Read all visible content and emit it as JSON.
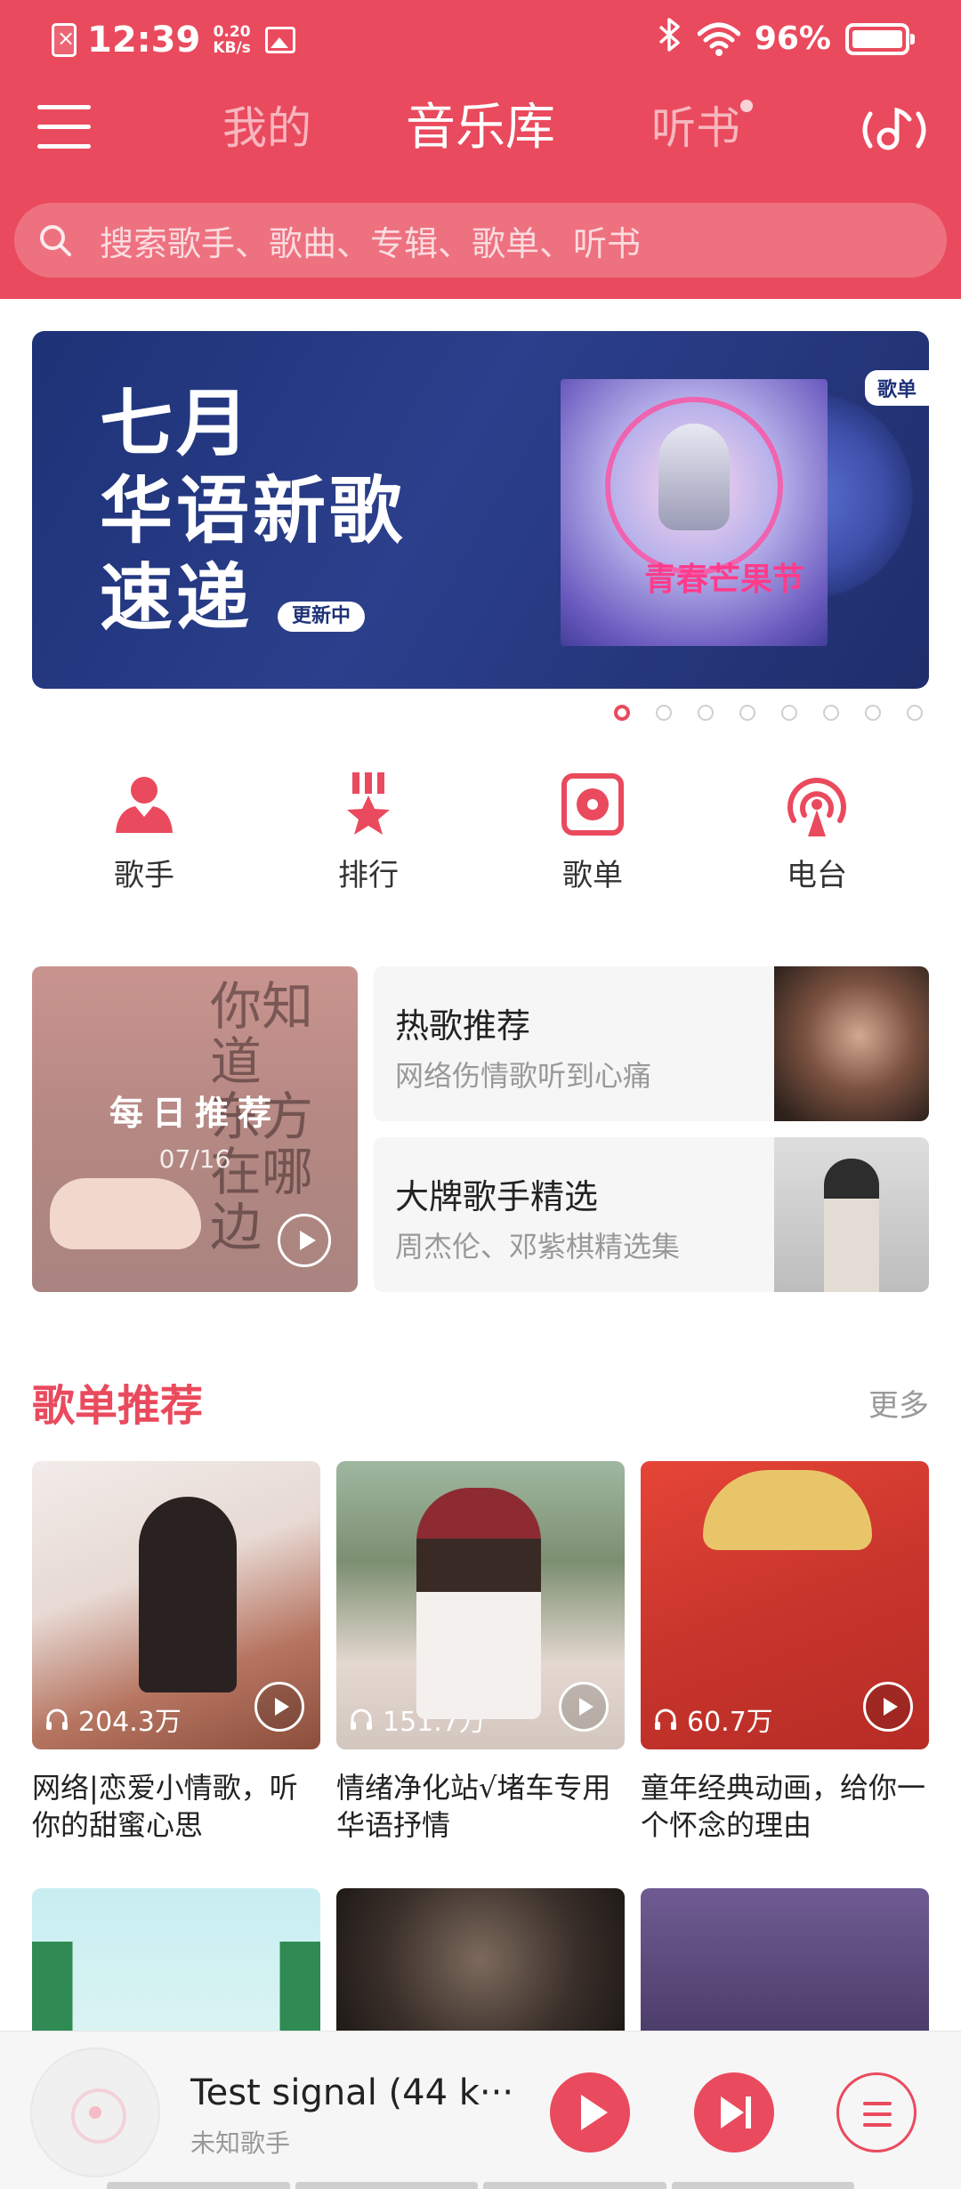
{
  "status_bar": {
    "time": "12:39",
    "speed_value": "0.20",
    "speed_unit": "KB/s",
    "battery": "96%"
  },
  "topnav": {
    "tab_mine": "我的",
    "tab_library": "音乐库",
    "tab_audiobook": "听书"
  },
  "search": {
    "placeholder": "搜索歌手、歌曲、专辑、歌单、听书"
  },
  "banner": {
    "line1": "七月",
    "line2": "华语新歌",
    "line3": "速递",
    "updating_badge": "更新中",
    "tag": "歌单",
    "art_text": "青春芒果节",
    "page_count": 8,
    "active_page": 1
  },
  "quick_entries": [
    {
      "label": "歌手",
      "icon": "singer-icon"
    },
    {
      "label": "排行",
      "icon": "ranking-icon"
    },
    {
      "label": "歌单",
      "icon": "playlist-icon"
    },
    {
      "label": "电台",
      "icon": "radio-icon"
    }
  ],
  "daily": {
    "title": "每日推荐",
    "date": "07/16",
    "calligraphy": "你知道\n东方\n在哪边"
  },
  "recommend_cards": [
    {
      "title": "热歌推荐",
      "subtitle": "网络伤情歌听到心痛"
    },
    {
      "title": "大牌歌手精选",
      "subtitle": "周杰伦、邓紫棋精选集"
    }
  ],
  "playlist_section": {
    "title": "歌单推荐",
    "more": "更多"
  },
  "playlists": [
    {
      "count": "204.3万",
      "name": "网络|恋爱小情歌，听你的甜蜜心思"
    },
    {
      "count": "151.7万",
      "name": "情绪净化站√堵车专用华语抒情"
    },
    {
      "count": "60.7万",
      "name": "童年经典动画，给你一个怀念的理由"
    }
  ],
  "player": {
    "title": "Test signal (44 k···",
    "artist": "未知歌手"
  },
  "colors": {
    "accent": "#ea4a5d",
    "banner_bg": "#1e3277"
  }
}
